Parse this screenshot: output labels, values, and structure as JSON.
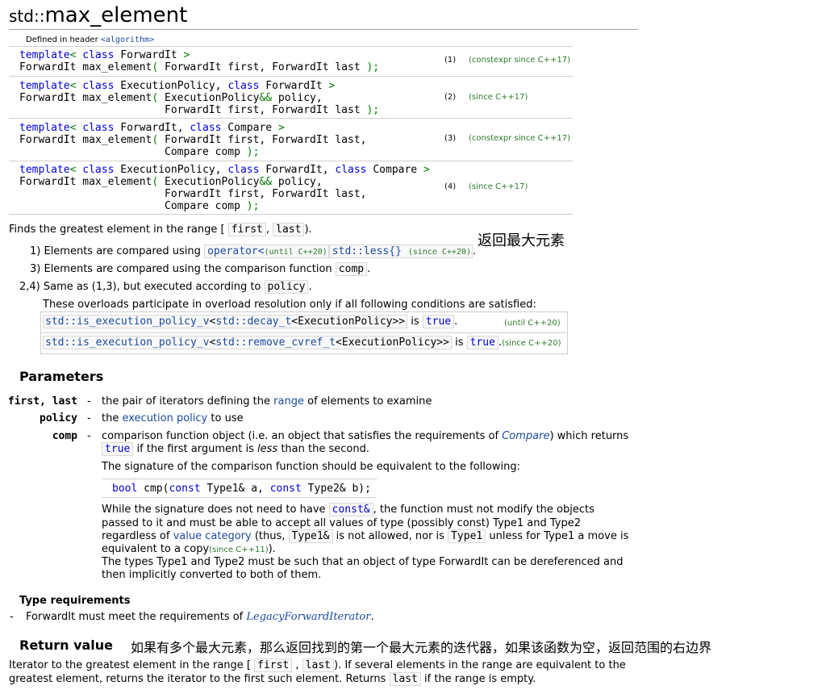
{
  "title": {
    "prefix": "std::",
    "name": "max_element"
  },
  "header": {
    "label": "Defined in header ",
    "file": "<algorithm>"
  },
  "overloads": [
    {
      "num": "(1)",
      "version": "(constexpr since C++17)",
      "lines": [
        "template< class ForwardIt >",
        "ForwardIt max_element( ForwardIt first, ForwardIt last );"
      ]
    },
    {
      "num": "(2)",
      "version": "(since C++17)",
      "lines": [
        "template< class ExecutionPolicy, class ForwardIt >",
        "ForwardIt max_element( ExecutionPolicy&& policy,",
        "                       ForwardIt first, ForwardIt last );"
      ]
    },
    {
      "num": "(3)",
      "version": "(constexpr since C++17)",
      "lines": [
        "template< class ForwardIt, class Compare >",
        "ForwardIt max_element( ForwardIt first, ForwardIt last,",
        "                       Compare comp );"
      ]
    },
    {
      "num": "(4)",
      "version": "(since C++17)",
      "lines": [
        "template< class ExecutionPolicy, class ForwardIt, class Compare >",
        "ForwardIt max_element( ExecutionPolicy&& policy,",
        "                       ForwardIt first, ForwardIt last,",
        "                       Compare comp );"
      ]
    }
  ],
  "intro": {
    "text": "Finds the greatest element in the range [",
    "first": "first",
    "comma": ",",
    "last": "last",
    "close": ")."
  },
  "annotation_top": "返回最大元素",
  "items": {
    "item1": {
      "num": "1)",
      "text": "Elements are compared using",
      "op": "operator<",
      "op_ver": "(until C++20)",
      "less": "std::less{}",
      "less_ver": "(since C++20)",
      "dot": "."
    },
    "item3": {
      "num": "3)",
      "text": "Elements are compared using the comparison function",
      "comp": "comp",
      "dot": "."
    },
    "item24": {
      "num": "2,4)",
      "text": "Same as (1,3), but executed according to",
      "policy": "policy",
      "dot": "."
    }
  },
  "overload_note": "These overloads participate in overload resolution only if all following conditions are satisfied:",
  "conditions": [
    {
      "expr_link": "std::is_execution_policy_v",
      "expr_mid": "<",
      "expr_link2": "std::decay_t",
      "expr_end": "<ExecutionPolicy>>",
      "is": "is",
      "val": "true",
      "dot": ".",
      "ver": "(until C++20)"
    },
    {
      "expr_link": "std::is_execution_policy_v",
      "expr_mid": "<",
      "expr_link2": "std::remove_cvref_t",
      "expr_end": "<ExecutionPolicy>>",
      "is": "is",
      "val": "true",
      "dot": ".",
      "ver": "(since C++20)"
    }
  ],
  "parameters": {
    "heading": "Parameters",
    "first_last": {
      "name": "first, last",
      "dash": "-",
      "pre": "the pair of iterators defining the",
      "link": "range",
      "post": "of elements to examine"
    },
    "policy": {
      "name": "policy",
      "dash": "-",
      "pre": "the",
      "link": "execution policy",
      "post": "to use"
    },
    "comp": {
      "name": "comp",
      "dash": "-",
      "l1_pre": "comparison function object (i.e. an object that satisfies the requirements of",
      "l1_link": "Compare",
      "l1_post": ") which returns",
      "l2_true": "true",
      "l2_a": "if the first argument is",
      "l2_less": "less",
      "l2_b": "than the second.",
      "sig_intro": "The signature of the comparison function should be equivalent to the following:",
      "sig_bool": "bool",
      "sig_cmp": "cmp(",
      "sig_const1": "const",
      "sig_mid": "Type1& a,",
      "sig_const2": "const",
      "sig_end": "Type2& b);",
      "w1_a": "While the signature does not need to have",
      "w1_const": "const&",
      "w1_b": ", the function must not modify the objects",
      "w2": "passed to it and must be able to accept all values of type (possibly const) Type1 and Type2",
      "w3_a": "regardless of",
      "w3_link": "value category",
      "w3_b": "(thus,",
      "w3_t1": "Type1&",
      "w3_c": "is not allowed",
      "w3_d": ", nor is",
      "w3_t2": "Type1",
      "w3_e": "unless for Type1 a move is",
      "w4_a": "equivalent to a copy",
      "w4_ver": "(since C++11)",
      "w4_b": ").",
      "w5": "The types Type1 and Type2 must be such that an object of type ForwardIt can be dereferenced and",
      "w6": "then implicitly converted to both of them."
    }
  },
  "type_req": {
    "heading": "Type requirements",
    "dash": "-",
    "pre": "ForwardIt must meet the requirements of",
    "link": "LegacyForwardIterator",
    "post": "."
  },
  "return_value": {
    "heading": "Return value",
    "annotation": "如果有多个最大元素，那么返回找到的第一个最大元素的迭代器，如果该函数为空，返回范围的右边界",
    "l1_a": "Iterator to the greatest element in the range [",
    "l1_first": "first",
    "l1_comma": ",",
    "l1_last": "last",
    "l1_b": "). If several elements in the range are equivalent to the",
    "l2_a": "greatest element, returns the iterator to the first such element. Returns",
    "l2_last": "last",
    "l2_b": "if the range is empty."
  }
}
